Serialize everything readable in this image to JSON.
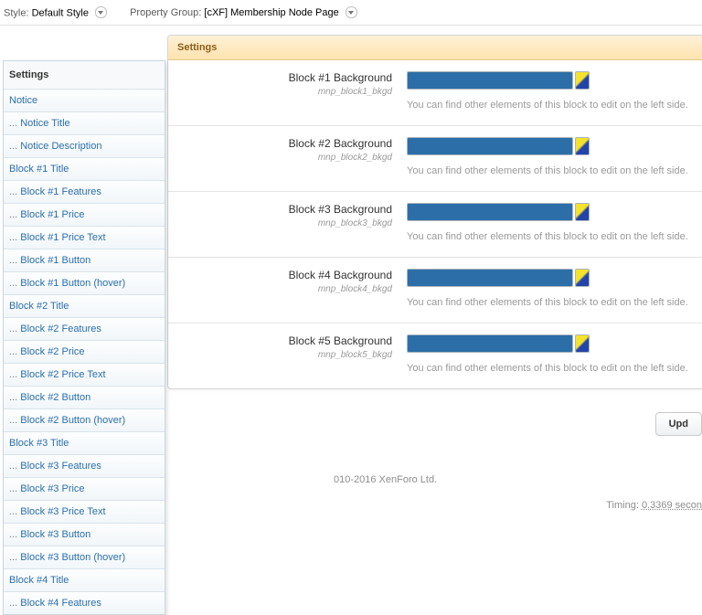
{
  "breadcrumb": {
    "style_label": "Style:",
    "style_value": "Default Style",
    "group_label": "Property Group:",
    "group_value": "[cXF] Membership Node Page"
  },
  "sidebar": {
    "heading": "Settings",
    "items": [
      {
        "text": "Notice",
        "kind": "sect"
      },
      {
        "text": "Notice Title",
        "kind": "sub"
      },
      {
        "text": "Notice Description",
        "kind": "sub"
      },
      {
        "text": "Block #1 Title",
        "kind": "sect"
      },
      {
        "text": "Block #1 Features",
        "kind": "sub"
      },
      {
        "text": "Block #1 Price",
        "kind": "sub"
      },
      {
        "text": "Block #1 Price Text",
        "kind": "sub"
      },
      {
        "text": "Block #1 Button",
        "kind": "sub"
      },
      {
        "text": "Block #1 Button (hover)",
        "kind": "sub"
      },
      {
        "text": "Block #2 Title",
        "kind": "sect"
      },
      {
        "text": "Block #2 Features",
        "kind": "sub"
      },
      {
        "text": "Block #2 Price",
        "kind": "sub"
      },
      {
        "text": "Block #2 Price Text",
        "kind": "sub"
      },
      {
        "text": "Block #2 Button",
        "kind": "sub"
      },
      {
        "text": "Block #2 Button (hover)",
        "kind": "sub"
      },
      {
        "text": "Block #3 Title",
        "kind": "sect"
      },
      {
        "text": "Block #3 Features",
        "kind": "sub"
      },
      {
        "text": "Block #3 Price",
        "kind": "sub"
      },
      {
        "text": "Block #3 Price Text",
        "kind": "sub"
      },
      {
        "text": "Block #3 Button",
        "kind": "sub"
      },
      {
        "text": "Block #3 Button (hover)",
        "kind": "sub"
      },
      {
        "text": "Block #4 Title",
        "kind": "sect"
      },
      {
        "text": "Block #4 Features",
        "kind": "sub"
      }
    ]
  },
  "panel": {
    "title": "Settings",
    "rows": [
      {
        "title": "Block #1 Background",
        "sub": "mnp_block1_bkgd",
        "help": "You can find other elements of this block to edit on the left side."
      },
      {
        "title": "Block #2 Background",
        "sub": "mnp_block2_bkgd",
        "help": "You can find other elements of this block to edit on the left side."
      },
      {
        "title": "Block #3 Background",
        "sub": "mnp_block3_bkgd",
        "help": "You can find other elements of this block to edit on the left side."
      },
      {
        "title": "Block #4 Background",
        "sub": "mnp_block4_bkgd",
        "help": "You can find other elements of this block to edit on the left side."
      },
      {
        "title": "Block #5 Background",
        "sub": "mnp_block5_bkgd",
        "help": "You can find other elements of this block to edit on the left side."
      }
    ],
    "update": "Upd"
  },
  "footer": {
    "copyright": "010-2016 XenForo Ltd.",
    "timing_label": "Timing: ",
    "timing_value": "0.3369 secon"
  }
}
